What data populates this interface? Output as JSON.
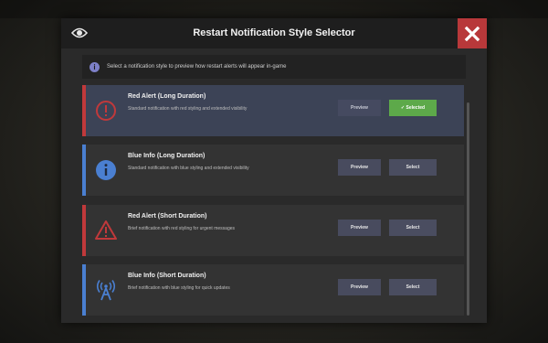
{
  "dialog": {
    "title": "Restart Notification Style Selector",
    "info_text": "Select a notification style to preview how restart alerts will appear in-game"
  },
  "styles": [
    {
      "name": "Red Alert (Long Duration)",
      "description": "Standard notification with red styling and extended visibility",
      "accent": "#c0393b",
      "icon": "exclamation-circle-icon",
      "preview_label": "Preview",
      "select_label": "✓ Selected",
      "selected": true
    },
    {
      "name": "Blue Info (Long Duration)",
      "description": "Standard notification with blue styling and extended visibility",
      "accent": "#4a7fd1",
      "icon": "info-circle-icon",
      "preview_label": "Preview",
      "select_label": "Select",
      "selected": false
    },
    {
      "name": "Red Alert (Short Duration)",
      "description": "Brief notification with red styling for urgent messages",
      "accent": "#c0393b",
      "icon": "warning-triangle-icon",
      "preview_label": "Preview",
      "select_label": "Select",
      "selected": false
    },
    {
      "name": "Blue Info (Short Duration)",
      "description": "Brief notification with blue styling for quick updates",
      "accent": "#4a7fd1",
      "icon": "broadcast-tower-icon",
      "preview_label": "Preview",
      "select_label": "Select",
      "selected": false
    }
  ],
  "colors": {
    "close_button": "#b8383a",
    "selected_button": "#5da94a",
    "selected_card": "#3c4356",
    "card": "#333333"
  }
}
